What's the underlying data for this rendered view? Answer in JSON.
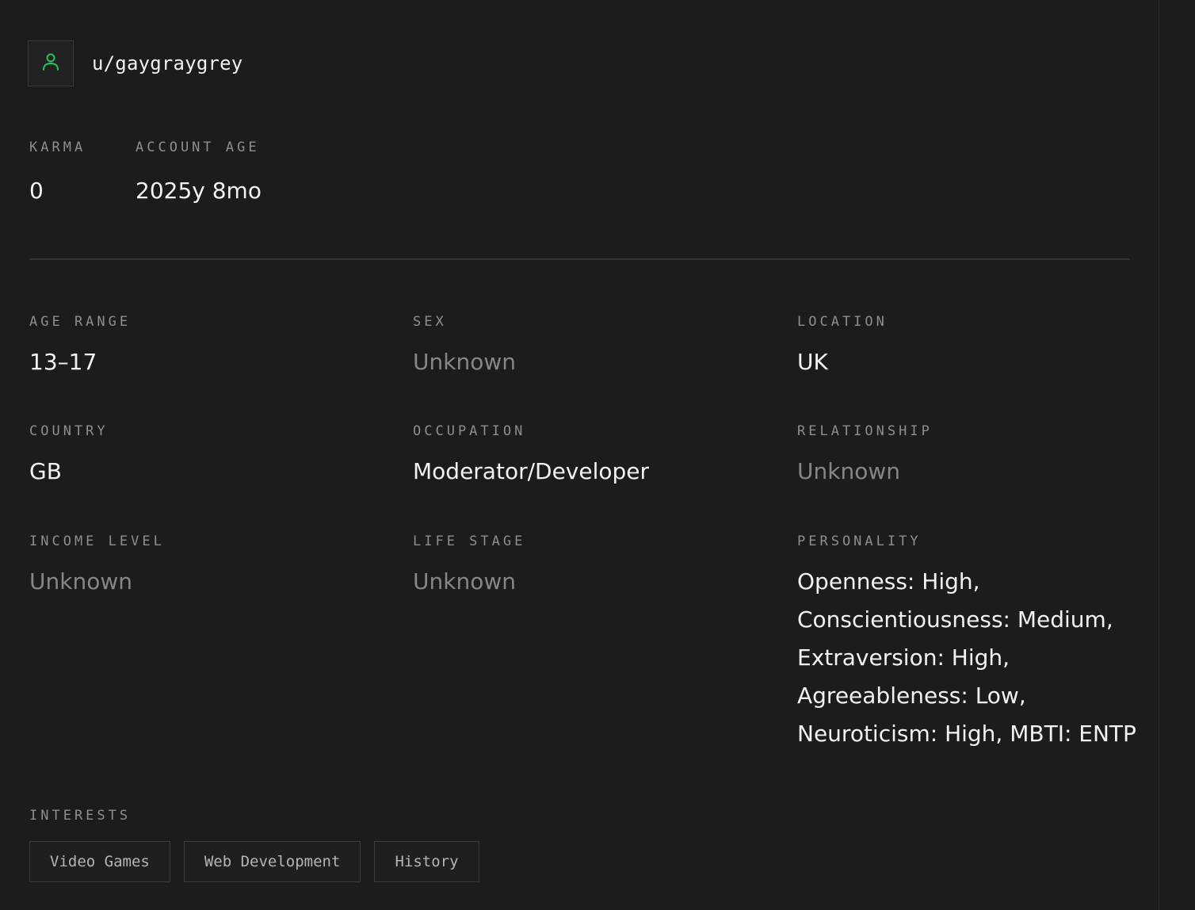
{
  "profile": {
    "username": "u/gaygraygrey",
    "avatar_icon": "user-icon",
    "accent_color": "#22c55e"
  },
  "stats": {
    "karma_label": "KARMA",
    "karma_value": "0",
    "account_age_label": "ACCOUNT AGE",
    "account_age_value": "2025y 8mo"
  },
  "fields": {
    "age_range": {
      "label": "AGE RANGE",
      "value": "13–17"
    },
    "sex": {
      "label": "SEX",
      "value": "Unknown"
    },
    "location": {
      "label": "LOCATION",
      "value": "UK"
    },
    "country": {
      "label": "COUNTRY",
      "value": "GB"
    },
    "occupation": {
      "label": "OCCUPATION",
      "value": "Moderator/Developer"
    },
    "relationship": {
      "label": "RELATIONSHIP",
      "value": "Unknown"
    },
    "income_level": {
      "label": "INCOME LEVEL",
      "value": "Unknown"
    },
    "life_stage": {
      "label": "LIFE STAGE",
      "value": "Unknown"
    },
    "personality": {
      "label": "PERSONALITY",
      "value": "Openness: High, Conscientiousness: Medium, Extraversion: High, Agreeableness: Low, Neuroticism: High, MBTI: ENTP"
    }
  },
  "interests": {
    "label": "INTERESTS",
    "items": [
      "Video Games",
      "Web Development",
      "History"
    ]
  }
}
